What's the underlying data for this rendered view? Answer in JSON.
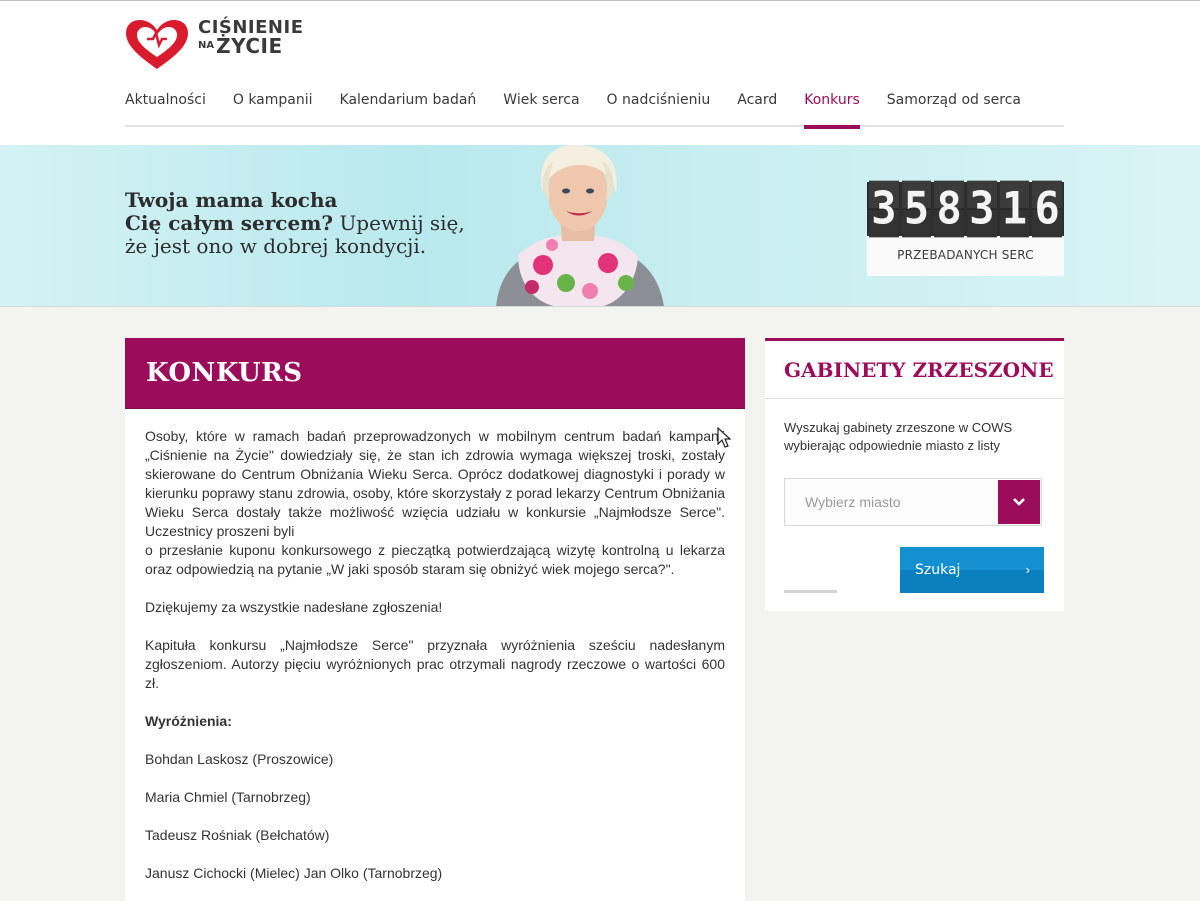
{
  "logo": {
    "line1": "CIŚNIENIE",
    "na": "NA",
    "line2": "ŻYCIE"
  },
  "nav": {
    "items": [
      {
        "label": "Aktualności"
      },
      {
        "label": "O kampanii"
      },
      {
        "label": "Kalendarium badań"
      },
      {
        "label": "Wiek serca"
      },
      {
        "label": "O nadciśnieniu"
      },
      {
        "label": "Acard"
      },
      {
        "label": "Konkurs"
      },
      {
        "label": "Samorząd od serca"
      }
    ],
    "active": "Konkurs"
  },
  "banner": {
    "bold_1": "Twoja mama kocha",
    "bold_2": "Cię całym sercem?",
    "rest_1": " Upewnij się,",
    "rest_2": "że jest ono w dobrej kondycji."
  },
  "counter": {
    "digits": [
      "3",
      "5",
      "8",
      "3",
      "1",
      "6"
    ],
    "label": "PRZEBADANYCH SERC"
  },
  "main": {
    "title": "KONKURS",
    "p1a": "Osoby, które w ramach badań przeprowadzonych w mobilnym centrum badań kampanii „Ciśnienie na Życie\" dowiedziały się, że stan ich zdrowia wymaga większej troski, zostały skierowane do Centrum Obniżania Wieku Serca. Oprócz dodatkowej diagnostyki i porady w kierunku poprawy stanu zdrowia, osoby, które skorzystały z porad lekarzy Centrum Obniżania Wieku Serca dostały także możliwość wzięcia udziału w konkursie „Najmłodsze Serce\". Uczestnicy proszeni byli",
    "p1b": "o przesłanie kuponu konkursowego z pieczątką potwierdzającą wizytę kontrolną u lekarza oraz odpowiedzią na pytanie „W jaki sposób staram się obniżyć wiek mojego serca?\".",
    "p2": "Dziękujemy za wszystkie nadesłane zgłoszenia!",
    "p3": "Kapituła konkursu „Najmłodsze Serce\" przyznała wyróżnienia sześciu nadesłanym zgłoszeniom. Autorzy pięciu wyróżnionych prac otrzymali nagrody rzeczowe o wartości 600 zł.",
    "heading": "Wyróżnienia:",
    "winners": [
      "Bohdan Laskosz (Proszowice)",
      "Maria Chmiel (Tarnobrzeg)",
      "Tadeusz Rośniak (Bełchatów)",
      "Janusz Cichocki (Mielec) Jan Olko (Tarnobrzeg)"
    ]
  },
  "sidebar": {
    "title": "GABINETY ZRZESZONE",
    "description": "Wyszukaj gabinety zrzeszone w COWS wybierając odpowiednie miasto z listy",
    "select_placeholder": "Wybierz miasto",
    "search_label": "Szukaj",
    "search_arrow": "›"
  },
  "colors": {
    "brand": "#9b0c5b",
    "button_blue": "#0a7fbe",
    "banner_bg": "#c8eef1"
  }
}
